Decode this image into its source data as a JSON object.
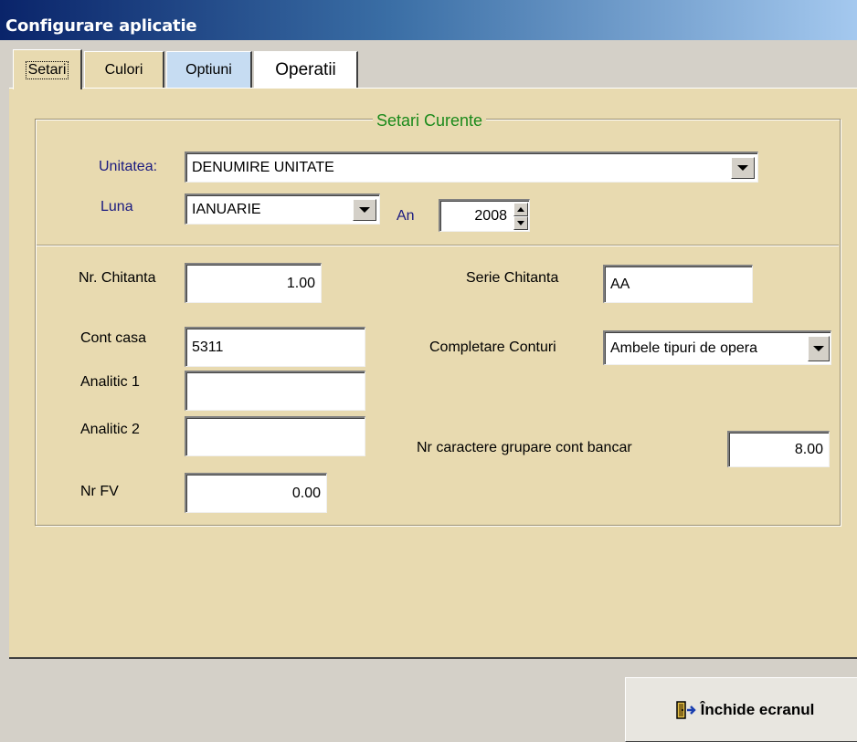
{
  "window": {
    "title": "Configurare aplicatie"
  },
  "tabs": [
    "Setari",
    "Culori",
    "Optiuni",
    "Operatii"
  ],
  "group": {
    "title": "Setari Curente"
  },
  "unitatea": {
    "label": "Unitatea:",
    "value": "DENUMIRE UNITATE"
  },
  "luna": {
    "label": "Luna",
    "value": "IANUARIE"
  },
  "an": {
    "label": "An",
    "value": "2008"
  },
  "nr_chitanta": {
    "label": "Nr. Chitanta",
    "value": "1.00"
  },
  "serie_chitanta": {
    "label": "Serie Chitanta",
    "value": "AA"
  },
  "cont_casa": {
    "label": "Cont casa",
    "value": "5311"
  },
  "completare_conturi": {
    "label": "Completare Conturi",
    "value": "Ambele tipuri de opera"
  },
  "analitic1": {
    "label": "Analitic 1",
    "value": ""
  },
  "analitic2": {
    "label": "Analitic 2",
    "value": ""
  },
  "nr_caractere": {
    "label": "Nr caractere grupare cont bancar",
    "value": "8.00"
  },
  "nr_fv": {
    "label": "Nr FV",
    "value": "0.00"
  },
  "close_button": {
    "label": "Închide ecranul",
    "icon": "exit-door-icon"
  },
  "colors": {
    "panel": "#e8dab0",
    "group_title": "#1b8a1b",
    "label_blue": "#1a1a80",
    "tab_optiuni": "#c6dcf2"
  }
}
